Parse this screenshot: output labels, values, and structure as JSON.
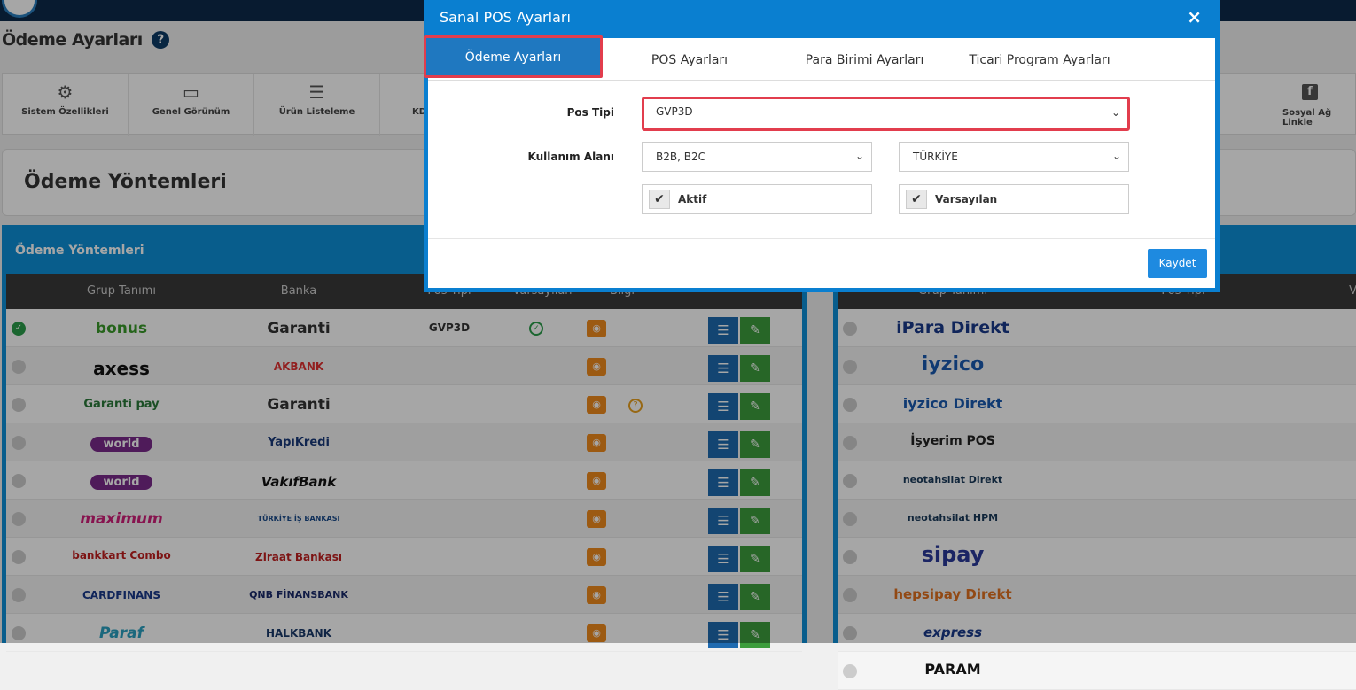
{
  "page": {
    "title": "Ödeme Ayarları",
    "help": "?"
  },
  "toolbar": {
    "items": [
      {
        "label": "Sistem Özellikleri",
        "icon": "gears-icon"
      },
      {
        "label": "Genel Görünüm",
        "icon": "monitor-icon"
      },
      {
        "label": "Ürün Listeleme",
        "icon": "list-icon"
      },
      {
        "label": "KD",
        "icon": ""
      },
      {
        "label": "Sosyal Ağ Linkle",
        "icon": "facebook-icon"
      }
    ]
  },
  "section": {
    "title": "Ödeme Yöntemleri"
  },
  "left_panel": {
    "title": "Ödeme Yöntemleri",
    "columns": [
      "Grup Tanımı",
      "Banka",
      "Pos Tipi",
      "Varsayılan",
      "Bilgi"
    ],
    "rows": [
      {
        "group": "bonus",
        "bank": "Garanti",
        "pos": "GVP3D",
        "default": true,
        "info": false,
        "selected": true
      },
      {
        "group": "axess",
        "bank": "AKBANK",
        "pos": "",
        "default": false,
        "info": false,
        "selected": false
      },
      {
        "group": "Garanti pay",
        "bank": "Garanti",
        "pos": "",
        "default": false,
        "info": true,
        "selected": false
      },
      {
        "group": "world",
        "bank": "YapıKredi",
        "pos": "",
        "default": false,
        "info": false,
        "selected": false
      },
      {
        "group": "world",
        "bank": "VakıfBank",
        "pos": "",
        "default": false,
        "info": false,
        "selected": false
      },
      {
        "group": "maximum",
        "bank": "TÜRKİYE İŞ BANKASI",
        "pos": "",
        "default": false,
        "info": false,
        "selected": false
      },
      {
        "group": "bankkart Combo",
        "bank": "Ziraat Bankası",
        "pos": "",
        "default": false,
        "info": false,
        "selected": false
      },
      {
        "group": "CARDFINANS",
        "bank": "QNB FİNANSBANK",
        "pos": "",
        "default": false,
        "info": false,
        "selected": false
      },
      {
        "group": "Paraf",
        "bank": "HALKBANK",
        "pos": "",
        "default": false,
        "info": false,
        "selected": false
      }
    ]
  },
  "right_panel": {
    "columns": [
      "Grup Tanımı",
      "Pos Tipi",
      "Va"
    ],
    "rows": [
      {
        "group": "iPara Direkt"
      },
      {
        "group": "iyzico"
      },
      {
        "group": "iyzico Direkt"
      },
      {
        "group": "İşyerim POS"
      },
      {
        "group": "neotahsilat Direkt"
      },
      {
        "group": "neotahsilat HPM"
      },
      {
        "group": "sipay"
      },
      {
        "group": "hepsipay Direkt"
      },
      {
        "group": "express"
      },
      {
        "group": "PARAM"
      }
    ]
  },
  "modal": {
    "title": "Sanal POS Ayarları",
    "close": "×",
    "tabs": [
      "Ödeme Ayarları",
      "POS Ayarları",
      "Para Birimi Ayarları",
      "Ticari Program Ayarları"
    ],
    "active_tab": 0,
    "pos_tipi_label": "Pos Tipi",
    "pos_tipi_value": "GVP3D",
    "kullanim_label": "Kullanım Alanı",
    "kullanim_value": "B2B, B2C",
    "country_value": "TÜRKİYE",
    "aktif_label": "Aktif",
    "aktif_checked": true,
    "varsayilan_label": "Varsayılan",
    "varsayilan_checked": true,
    "save_label": "Kaydet"
  },
  "colors": {
    "modal_header": "#0a7fd0",
    "highlight": "#e23d4d",
    "save_button": "#1e8ae0",
    "panel_border": "#0d8fd8"
  }
}
